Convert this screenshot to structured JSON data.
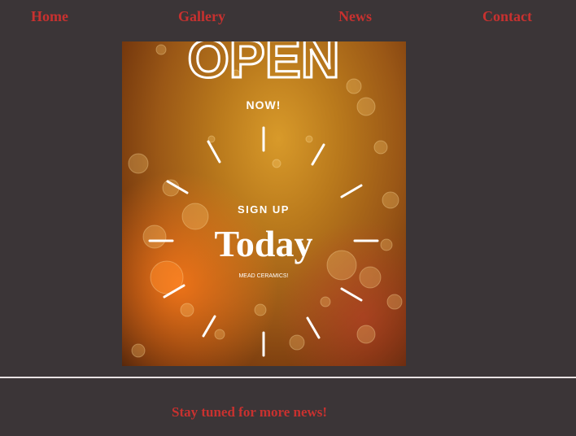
{
  "nav": {
    "home": "Home",
    "gallery": "Gallery",
    "news": "News",
    "contact": "Contact"
  },
  "poster": {
    "headline": "OPEN",
    "subheadline": "NOW!",
    "sign_up": "SIGN UP",
    "today": "Today",
    "brand": "MEAD CERAMICS!"
  },
  "footer": {
    "message": "Stay tuned for more news!"
  },
  "colors": {
    "background": "#3b3537",
    "link": "#c8312f",
    "divider": "#e8e2e2",
    "poster_text": "#ffffff"
  }
}
